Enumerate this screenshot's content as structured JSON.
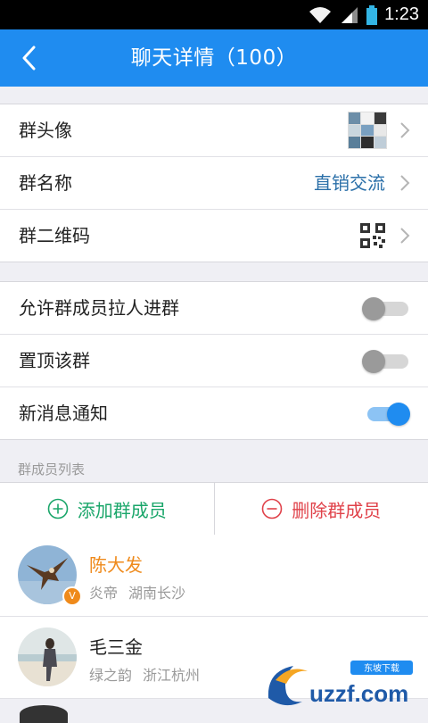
{
  "status_bar": {
    "time": "1:23"
  },
  "nav": {
    "title": "聊天详情（100）"
  },
  "group_info": {
    "avatar_label": "群头像",
    "name_label": "群名称",
    "name_value": "直销交流",
    "qr_label": "群二维码"
  },
  "settings": [
    {
      "label": "允许群成员拉人进群",
      "enabled": false
    },
    {
      "label": "置顶该群",
      "enabled": false
    },
    {
      "label": "新消息通知",
      "enabled": true
    }
  ],
  "members_section": {
    "title": "群成员列表",
    "add_label": "添加群成员",
    "remove_label": "删除群成员"
  },
  "members": [
    {
      "name": "陈大发",
      "nickname": "炎帝",
      "location": "湖南长沙",
      "badge": "V"
    },
    {
      "name": "毛三金",
      "nickname": "绿之韵",
      "location": "浙江杭州"
    }
  ],
  "watermark": {
    "main": "uzzf.com",
    "sub": "东坡下载"
  },
  "colors": {
    "primary": "#1f8cf0",
    "add": "#1aa66a",
    "remove": "#e0424a",
    "highlight": "#ef8a1b"
  }
}
